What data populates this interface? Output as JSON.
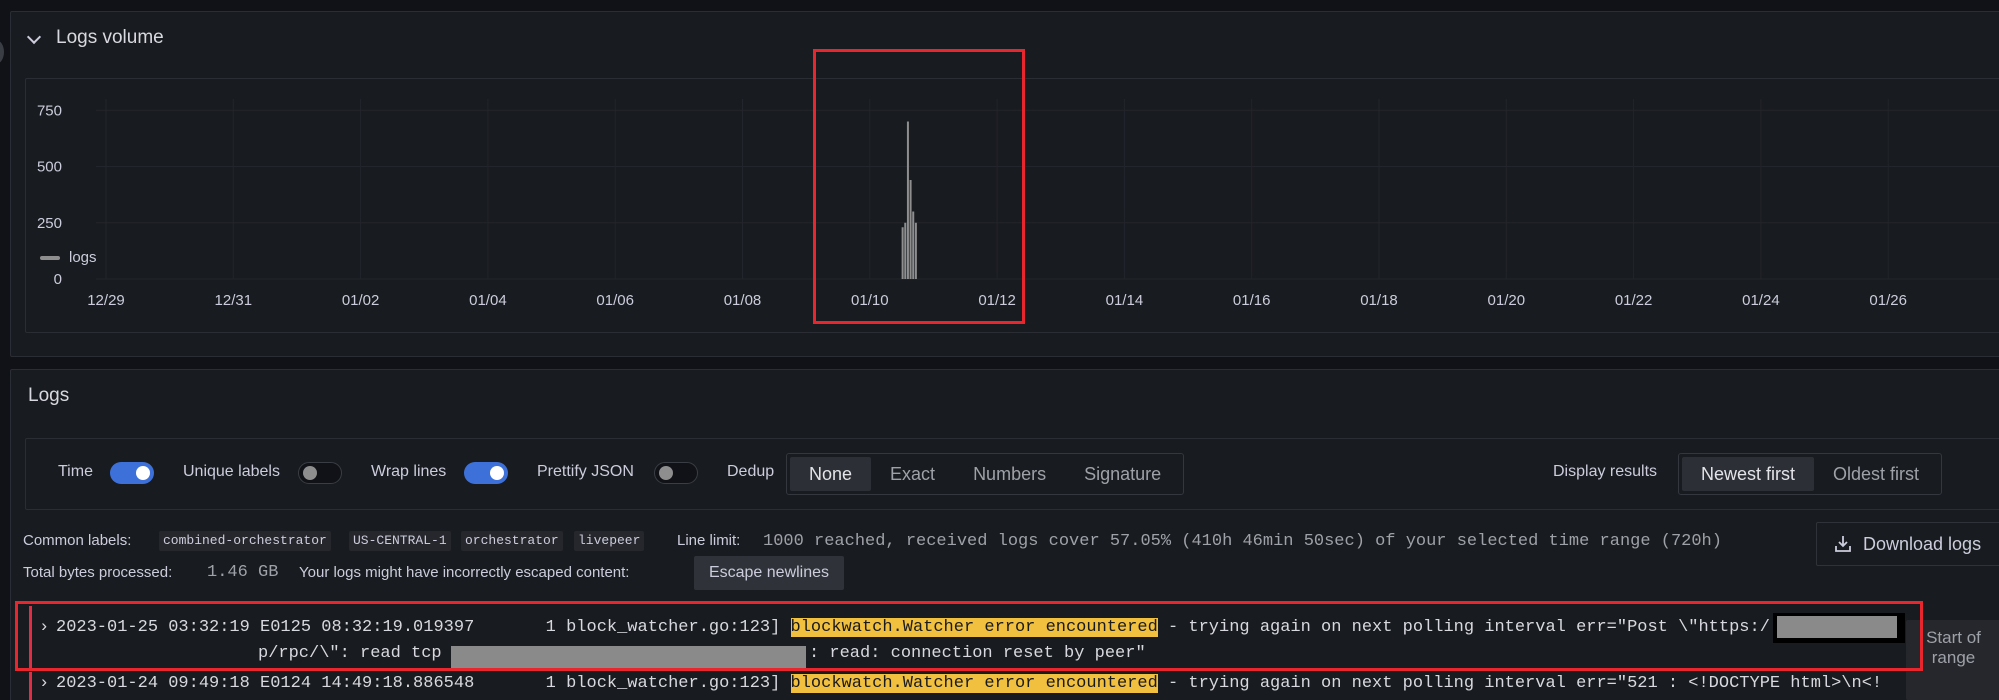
{
  "volume_panel": {
    "title": "Logs volume",
    "legend": "logs"
  },
  "chart_data": {
    "type": "bar",
    "x_ticks": [
      "12/29",
      "12/31",
      "01/02",
      "01/04",
      "01/06",
      "01/08",
      "01/10",
      "01/12",
      "01/14",
      "01/16",
      "01/18",
      "01/20",
      "01/22",
      "01/24",
      "01/26"
    ],
    "y_ticks": [
      "750",
      "500",
      "250",
      "0"
    ],
    "ylim": [
      0,
      800
    ],
    "series": [
      {
        "name": "logs",
        "points": [
          {
            "x": "01/10 12:00",
            "y": 230
          },
          {
            "x": "01/10 13:00",
            "y": 250
          },
          {
            "x": "01/10 14:00",
            "y": 700
          },
          {
            "x": "01/10 15:00",
            "y": 440
          },
          {
            "x": "01/10 16:00",
            "y": 300
          },
          {
            "x": "01/10 17:00",
            "y": 250
          }
        ]
      }
    ],
    "grid": true,
    "legend_position": "bottom-left"
  },
  "logs_panel": {
    "title": "Logs",
    "options": {
      "time_label": "Time",
      "time_on": true,
      "unique_labels_label": "Unique labels",
      "unique_labels_on": false,
      "wrap_lines_label": "Wrap lines",
      "wrap_lines_on": true,
      "prettify_json_label": "Prettify JSON",
      "prettify_json_on": false,
      "dedup_label": "Dedup",
      "dedup_options": [
        "None",
        "Exact",
        "Numbers",
        "Signature"
      ],
      "dedup_selected": "None",
      "display_results_label": "Display results",
      "display_options": [
        "Newest first",
        "Oldest first"
      ],
      "display_selected": "Newest first"
    },
    "meta": {
      "common_labels_key": "Common labels:",
      "common_labels": [
        "combined-orchestrator",
        "US-CENTRAL-1",
        "orchestrator",
        "livepeer"
      ],
      "line_limit_key": "Line limit:",
      "line_limit_value": "1000 reached, received logs cover 57.05% (410h 46min 50sec) of your selected time range (720h)",
      "total_bytes_key": "Total bytes processed:",
      "total_bytes_value": "1.46 GB",
      "escape_warning": "Your logs might have incorrectly escaped content:",
      "escape_button": "Escape newlines",
      "download_button": "Download logs"
    },
    "rows": [
      {
        "prefix": "2023-01-25 03:32:19 E0125 08:32:19.019397       1 block_watcher.go:123] ",
        "highlight": "blockwatch.Watcher error encountered",
        "suffix": " - trying again on next polling interval err=\"Post \\\"https:/",
        "line2_a": "p/rpc/\\\": read tcp ",
        "line2_b": ": read: connection reset by peer\""
      },
      {
        "prefix": "2023-01-24 09:49:18 E0124 14:49:18.886548       1 block_watcher.go:123] ",
        "highlight": "blockwatch.Watcher error encountered",
        "suffix": " - trying again on next polling interval err=\"521 : <!DOCTYPE html>\\n<!"
      }
    ],
    "start_range": "Start of range"
  },
  "colors": {
    "accent": "#3d71d9",
    "highlight": "#f2c03f",
    "annotation": "#e8262e"
  }
}
